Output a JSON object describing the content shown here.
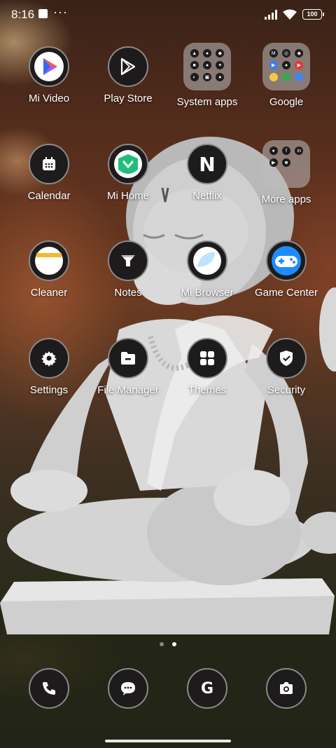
{
  "status_bar": {
    "time": "8:16",
    "battery": "100"
  },
  "apps": [
    {
      "label": "Mi Video",
      "icon": "mi-video-icon"
    },
    {
      "label": "Play Store",
      "icon": "play-store-icon"
    },
    {
      "label": "System apps",
      "icon": "folder-icon"
    },
    {
      "label": "Google",
      "icon": "folder-icon"
    },
    {
      "label": "Calendar",
      "icon": "calendar-icon"
    },
    {
      "label": "Mi Home",
      "icon": "mi-home-icon"
    },
    {
      "label": "Netflix",
      "icon": "netflix-icon"
    },
    {
      "label": "More apps",
      "icon": "folder-icon"
    },
    {
      "label": "Cleaner",
      "icon": "cleaner-icon"
    },
    {
      "label": "Notes",
      "icon": "notes-icon"
    },
    {
      "label": "Mi Browser",
      "icon": "browser-icon"
    },
    {
      "label": "Game Center",
      "icon": "gamepad-icon"
    },
    {
      "label": "Settings",
      "icon": "gear-icon"
    },
    {
      "label": "File Manager",
      "icon": "folder-file-icon"
    },
    {
      "label": "Themes",
      "icon": "themes-icon"
    },
    {
      "label": "Security",
      "icon": "shield-icon"
    }
  ],
  "dock": [
    {
      "name": "phone",
      "icon": "phone-icon"
    },
    {
      "name": "messages",
      "icon": "message-icon"
    },
    {
      "name": "google",
      "icon": "google-g-icon"
    },
    {
      "name": "camera",
      "icon": "camera-icon"
    }
  ],
  "netflix_letter": "N",
  "google_letter": "G",
  "page_indicator": {
    "pages": 2,
    "active": 2
  }
}
